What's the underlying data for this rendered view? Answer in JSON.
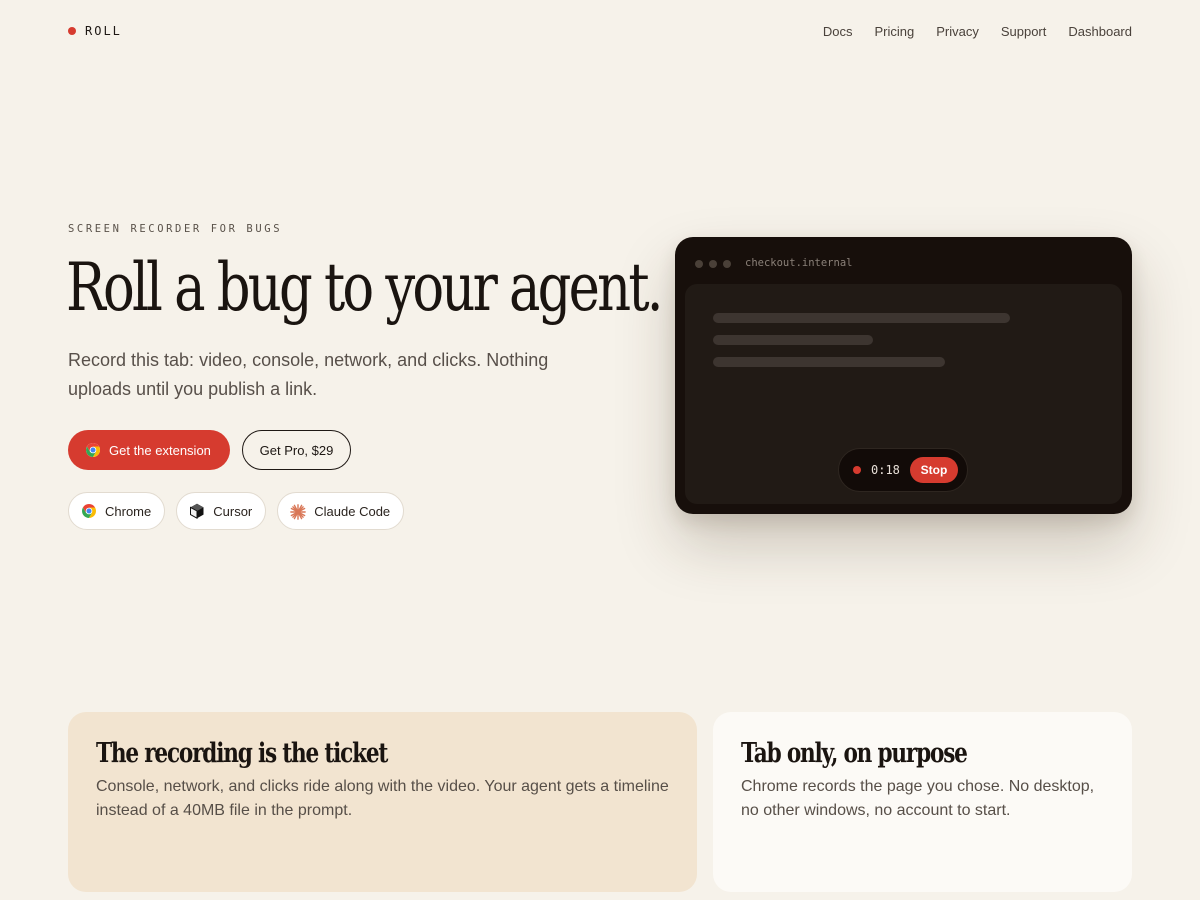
{
  "brand": {
    "name": "ROLL",
    "accent": "#d63b2f"
  },
  "nav": {
    "links": [
      "Docs",
      "Pricing",
      "Privacy",
      "Support",
      "Dashboard"
    ]
  },
  "hero": {
    "eyebrow": "SCREEN RECORDER FOR BUGS",
    "headline": "Roll a bug to your agent.",
    "subline": "Record this tab: video, console, network, and clicks. Nothing uploads until you publish a link.",
    "primary_cta": {
      "label": "Get the extension",
      "icon": "chrome-icon"
    },
    "secondary_cta": {
      "label": "Get Pro, $29"
    },
    "integrations": [
      {
        "label": "Chrome",
        "icon": "chrome-icon"
      },
      {
        "label": "Cursor",
        "icon": "cursor-icon"
      },
      {
        "label": "Claude Code",
        "icon": "claude-icon"
      }
    ]
  },
  "recorder": {
    "url": "checkout.internal",
    "timer": "0:18",
    "stop_label": "Stop"
  },
  "features": [
    {
      "title": "The recording is the ticket",
      "body": "Console, network, and clicks ride along with the video. Your agent gets a timeline instead of a 40MB file in the prompt."
    },
    {
      "title": "Tab only, on purpose",
      "body": "Chrome records the page you chose. No desktop, no other windows, no account to start."
    }
  ]
}
